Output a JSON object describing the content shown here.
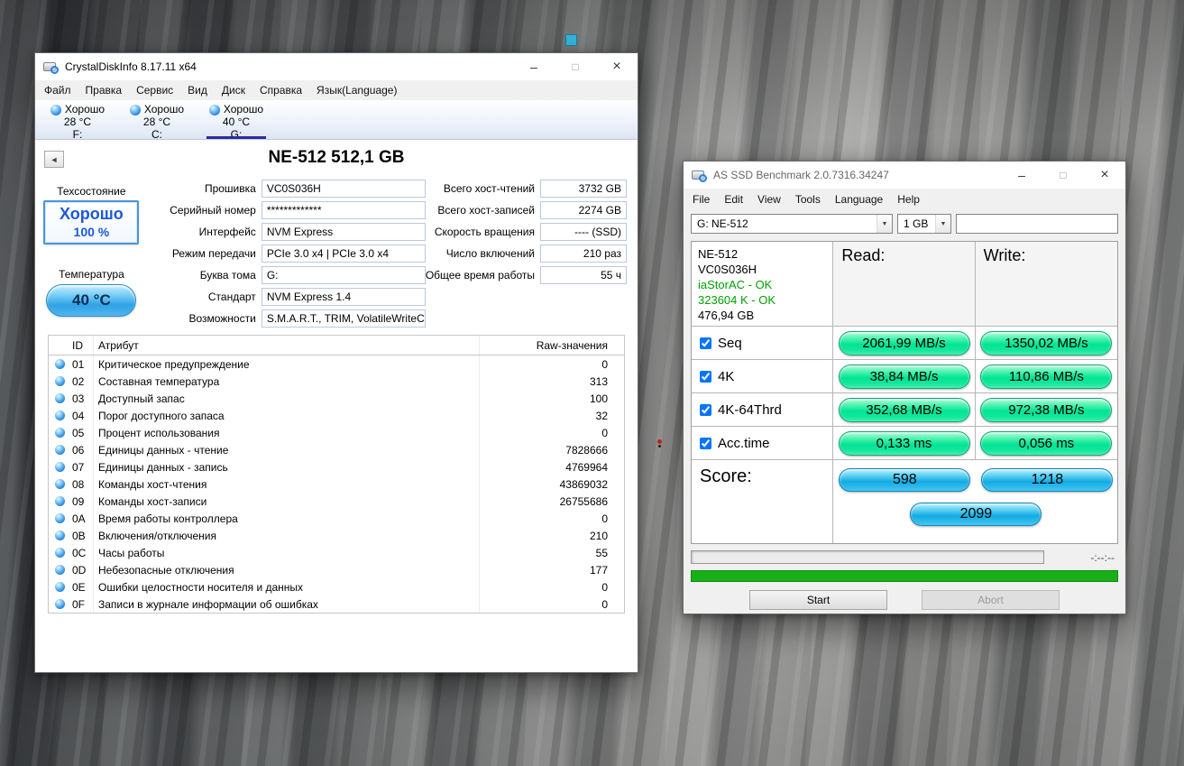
{
  "chrome": {
    "minimize": "–",
    "maximize": "□",
    "close": "×",
    "back": "◄",
    "dropdown": "▼"
  },
  "colors": {
    "health-blue": "#1d58d8",
    "ok-green": "#00a000",
    "progress-green": "#17b117",
    "selected-underline": "#2b2ba0",
    "result-green": "#03e394",
    "score-blue": "#12abe3",
    "orb-blue": "#2a8be0"
  },
  "cdi": {
    "title": "CrystalDiskInfo 8.17.11 x64",
    "menu": [
      "Файл",
      "Правка",
      "Сервис",
      "Вид",
      "Диск",
      "Справка",
      "Язык(Language)"
    ],
    "drives": [
      {
        "status": "Хорошо",
        "temp": "28 °C",
        "letter": "F:",
        "selected": false
      },
      {
        "status": "Хорошо",
        "temp": "28 °C",
        "letter": "C:",
        "selected": false
      },
      {
        "status": "Хорошо",
        "temp": "40 °C",
        "letter": "G:",
        "selected": true
      }
    ],
    "drive_title": "NE-512 512,1 GB",
    "health": {
      "label": "Техсостояние",
      "status": "Хорошо",
      "percent": "100 %"
    },
    "temperature": {
      "label": "Температура",
      "value": "40 °C"
    },
    "drive_fields": [
      {
        "label": "Прошивка",
        "value": "VC0S036H"
      },
      {
        "label": "Серийный номер",
        "value": "*************"
      },
      {
        "label": "Интерфейс",
        "value": "NVM Express"
      },
      {
        "label": "Режим передачи",
        "value": "PCIe 3.0 x4 | PCIe 3.0 x4"
      },
      {
        "label": "Буква тома",
        "value": "G:"
      },
      {
        "label": "Стандарт",
        "value": "NVM Express 1.4"
      },
      {
        "label": "Возможности",
        "value": "S.M.A.R.T., TRIM, VolatileWriteCache"
      }
    ],
    "host_fields": [
      {
        "label": "Всего хост-чтений",
        "value": "3732 GB"
      },
      {
        "label": "Всего хост-записей",
        "value": "2274 GB"
      },
      {
        "label": "Скорость вращения",
        "value": "---- (SSD)"
      },
      {
        "label": "Число включений",
        "value": "210 раз"
      },
      {
        "label": "Общее время работы",
        "value": "55 ч"
      }
    ],
    "smart": {
      "id_header": "ID",
      "attr_header": "Атрибут",
      "raw_header": "Raw-значения",
      "rows": [
        {
          "id": "01",
          "attribute": "Критическое предупреждение",
          "raw": "0"
        },
        {
          "id": "02",
          "attribute": "Составная температура",
          "raw": "313"
        },
        {
          "id": "03",
          "attribute": "Доступный запас",
          "raw": "100"
        },
        {
          "id": "04",
          "attribute": "Порог доступного запаса",
          "raw": "32"
        },
        {
          "id": "05",
          "attribute": "Процент использования",
          "raw": "0"
        },
        {
          "id": "06",
          "attribute": "Единицы данных - чтение",
          "raw": "7828666"
        },
        {
          "id": "07",
          "attribute": "Единицы данных - запись",
          "raw": "4769964"
        },
        {
          "id": "08",
          "attribute": "Команды хост-чтения",
          "raw": "43869032"
        },
        {
          "id": "09",
          "attribute": "Команды хост-записи",
          "raw": "26755686"
        },
        {
          "id": "0A",
          "attribute": "Время работы контроллера",
          "raw": "0"
        },
        {
          "id": "0B",
          "attribute": "Включения/отключения",
          "raw": "210"
        },
        {
          "id": "0C",
          "attribute": "Часы работы",
          "raw": "55"
        },
        {
          "id": "0D",
          "attribute": "Небезопасные отключения",
          "raw": "177"
        },
        {
          "id": "0E",
          "attribute": "Ошибки целостности носителя и данных",
          "raw": "0"
        },
        {
          "id": "0F",
          "attribute": "Записи в журнале информации об ошибках",
          "raw": "0"
        }
      ]
    }
  },
  "assd": {
    "title": "AS SSD Benchmark 2.0.7316.34247",
    "menu": [
      "File",
      "Edit",
      "View",
      "Tools",
      "Language",
      "Help"
    ],
    "drive_combo": "G: NE-512",
    "size_combo": "1 GB",
    "text_field": "",
    "info": {
      "model": "NE-512",
      "firmware": "VC0S036H",
      "driver": "iaStorAC - OK",
      "alignment": "323604 K - OK",
      "capacity": "476,94 GB"
    },
    "read_header": "Read:",
    "write_header": "Write:",
    "tests": [
      {
        "label": "Seq",
        "checked": true,
        "read": "2061,99 MB/s",
        "write": "1350,02 MB/s"
      },
      {
        "label": "4K",
        "checked": true,
        "read": "38,84 MB/s",
        "write": "110,86 MB/s"
      },
      {
        "label": "4K-64Thrd",
        "checked": true,
        "read": "352,68 MB/s",
        "write": "972,38 MB/s"
      },
      {
        "label": "Acc.time",
        "checked": true,
        "read": "0,133 ms",
        "write": "0,056 ms"
      }
    ],
    "score": {
      "label": "Score:",
      "read": "598",
      "write": "1218",
      "total": "2099"
    },
    "elapsed": "-:--:--",
    "start_button": "Start",
    "abort_button": "Abort"
  }
}
